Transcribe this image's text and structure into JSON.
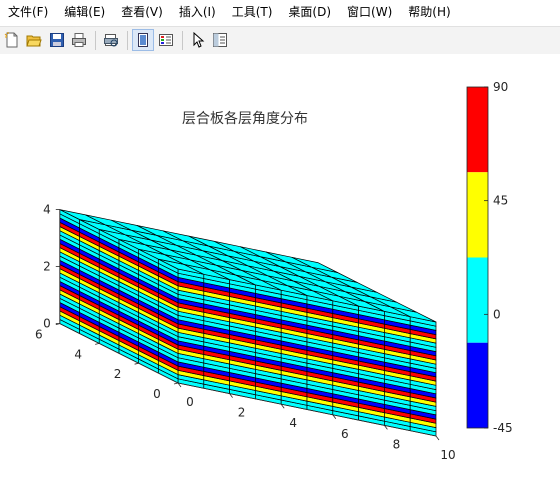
{
  "menu": [
    "文件(F)",
    "编辑(E)",
    "查看(V)",
    "插入(I)",
    "工具(T)",
    "桌面(D)",
    "窗口(W)",
    "帮助(H)"
  ],
  "toolbar": {
    "buttons": [
      "new-file-icon",
      "open-folder-icon",
      "save-icon",
      "print-icon",
      "print-preview-icon",
      "dock-figure-icon",
      "insert-colorbar-icon",
      "pointer-icon",
      "property-editor-icon"
    ],
    "pressed": "dock-figure-icon"
  },
  "chart_data": {
    "type": "3d-bar",
    "title": "层合板各层角度分布",
    "xlabel": "",
    "ylabel": "",
    "zlabel": "",
    "xlim": [
      0,
      10
    ],
    "ylim": [
      0,
      6
    ],
    "zlim": [
      0,
      4
    ],
    "xticks": [
      "0",
      "2",
      "4",
      "6",
      "8",
      "10"
    ],
    "yticks": [
      "0",
      "2",
      "4",
      "6"
    ],
    "zticks": [
      "0",
      "2",
      "4"
    ],
    "grid_x": 10,
    "grid_y": 6,
    "layers_bottom_to_top": [
      0,
      0,
      45,
      90,
      -45,
      0,
      0,
      45,
      90,
      -45,
      0,
      0,
      45,
      90,
      -45,
      0,
      0,
      45,
      90,
      -45,
      0,
      0,
      45,
      90,
      -45,
      0,
      0
    ],
    "colormap": {
      "limits": [
        -45,
        90
      ],
      "colors": [
        "#0000ff",
        "#00ffff",
        "#ffff00",
        "#ff0000"
      ],
      "ticks": [
        "90",
        "45",
        "0",
        "-45"
      ]
    }
  }
}
